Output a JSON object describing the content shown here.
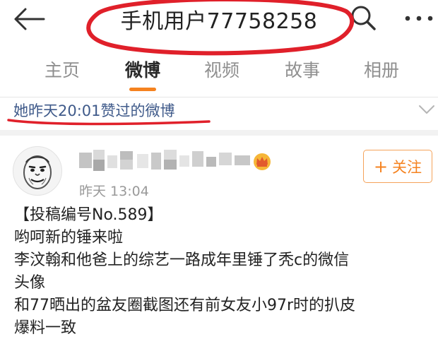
{
  "header": {
    "title": "手机用户77758258",
    "icons": {
      "back": "back-arrow-icon",
      "search": "search-icon",
      "more": "more-dots-icon"
    }
  },
  "tabs": [
    {
      "label": "主页",
      "active": false
    },
    {
      "label": "微博",
      "active": true
    },
    {
      "label": "视频",
      "active": false
    },
    {
      "label": "故事",
      "active": false
    },
    {
      "label": "相册",
      "active": false
    }
  ],
  "banner": {
    "text": "她昨天20:01赞过的微博",
    "icon": "chevron-down-icon"
  },
  "post": {
    "time": "昨天 13:04",
    "badge_icon": "crown-badge-icon",
    "follow_button": {
      "label": "关注",
      "icon": "plus-icon"
    },
    "lines": [
      "【投稿编号No.589】",
      "哟呵新的锤来啦",
      "李汶翰和他爸上的综艺一路成年里锤了秃c的微信",
      "头像",
      "和77晒出的盆友圈截图还有前女友小97r时的扒皮",
      "爆料一致"
    ]
  },
  "colors": {
    "accent": "#f5821f",
    "link": "#3f5a8a",
    "annotation_red": "#e0202a",
    "muted": "#8f8f8f"
  }
}
